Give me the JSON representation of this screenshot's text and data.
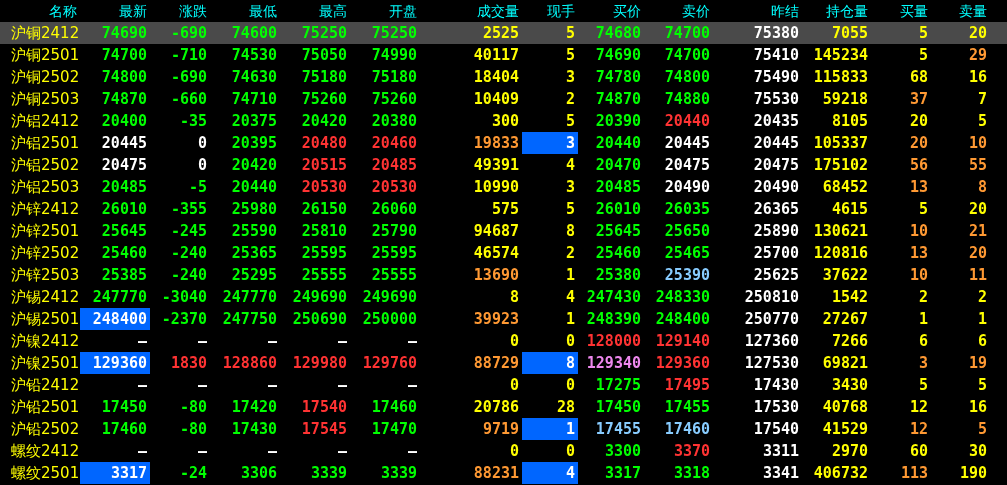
{
  "columns": [
    "名称",
    "最新",
    "涨跌",
    "最低",
    "最高",
    "开盘",
    "成交量",
    "现手",
    "买价",
    "卖价",
    "昨结",
    "持仓量",
    "买量",
    "卖量"
  ],
  "rows": [
    {
      "name": "沪铜2412",
      "selected": true,
      "cells": [
        {
          "text": "74690",
          "color": "#00ff00",
          "highlighted": false
        },
        {
          "text": "-690",
          "color": "#00ff00",
          "highlighted": false
        },
        {
          "text": "74600",
          "color": "#00ff00",
          "highlighted": false
        },
        {
          "text": "75250",
          "color": "#00ff00",
          "highlighted": false
        },
        {
          "text": "75250",
          "color": "#00ff00",
          "highlighted": false
        },
        {
          "text": "2525",
          "color": "#ffff00",
          "highlighted": false
        },
        {
          "text": "5",
          "color": "#ffff00",
          "highlighted": false
        },
        {
          "text": "74680",
          "color": "#00ff00",
          "highlighted": false
        },
        {
          "text": "74700",
          "color": "#00ff00",
          "highlighted": false
        },
        {
          "text": "75380",
          "color": "#ffffff",
          "highlighted": false
        },
        {
          "text": "7055",
          "color": "#ffff00",
          "highlighted": false
        },
        {
          "text": "5",
          "color": "#ffff00",
          "highlighted": false
        },
        {
          "text": "20",
          "color": "#ffff00",
          "highlighted": false
        }
      ]
    },
    {
      "name": "沪铜2501",
      "selected": false,
      "cells": [
        {
          "text": "74700",
          "color": "#00ff00",
          "highlighted": false
        },
        {
          "text": "-710",
          "color": "#00ff00",
          "highlighted": false
        },
        {
          "text": "74530",
          "color": "#00ff00",
          "highlighted": false
        },
        {
          "text": "75050",
          "color": "#00ff00",
          "highlighted": false
        },
        {
          "text": "74990",
          "color": "#00ff00",
          "highlighted": false
        },
        {
          "text": "40117",
          "color": "#ffff00",
          "highlighted": false
        },
        {
          "text": "5",
          "color": "#ffff00",
          "highlighted": false
        },
        {
          "text": "74690",
          "color": "#00ff00",
          "highlighted": false
        },
        {
          "text": "74700",
          "color": "#00ff00",
          "highlighted": false
        },
        {
          "text": "75410",
          "color": "#ffffff",
          "highlighted": false
        },
        {
          "text": "145234",
          "color": "#ffff00",
          "highlighted": false
        },
        {
          "text": "5",
          "color": "#ffff00",
          "highlighted": false
        },
        {
          "text": "29",
          "color": "#ff9933",
          "highlighted": false
        }
      ]
    },
    {
      "name": "沪铜2502",
      "selected": false,
      "cells": [
        {
          "text": "74800",
          "color": "#00ff00",
          "highlighted": false
        },
        {
          "text": "-690",
          "color": "#00ff00",
          "highlighted": false
        },
        {
          "text": "74630",
          "color": "#00ff00",
          "highlighted": false
        },
        {
          "text": "75180",
          "color": "#00ff00",
          "highlighted": false
        },
        {
          "text": "75180",
          "color": "#00ff00",
          "highlighted": false
        },
        {
          "text": "18404",
          "color": "#ffff00",
          "highlighted": false
        },
        {
          "text": "3",
          "color": "#ffff00",
          "highlighted": false
        },
        {
          "text": "74780",
          "color": "#00ff00",
          "highlighted": false
        },
        {
          "text": "74800",
          "color": "#00ff00",
          "highlighted": false
        },
        {
          "text": "75490",
          "color": "#ffffff",
          "highlighted": false
        },
        {
          "text": "115833",
          "color": "#ffff00",
          "highlighted": false
        },
        {
          "text": "68",
          "color": "#ffff00",
          "highlighted": false
        },
        {
          "text": "16",
          "color": "#ffff00",
          "highlighted": false
        }
      ]
    },
    {
      "name": "沪铜2503",
      "selected": false,
      "cells": [
        {
          "text": "74870",
          "color": "#00ff00",
          "highlighted": false
        },
        {
          "text": "-660",
          "color": "#00ff00",
          "highlighted": false
        },
        {
          "text": "74710",
          "color": "#00ff00",
          "highlighted": false
        },
        {
          "text": "75260",
          "color": "#00ff00",
          "highlighted": false
        },
        {
          "text": "75260",
          "color": "#00ff00",
          "highlighted": false
        },
        {
          "text": "10409",
          "color": "#ffff00",
          "highlighted": false
        },
        {
          "text": "2",
          "color": "#ffff00",
          "highlighted": false
        },
        {
          "text": "74870",
          "color": "#00ff00",
          "highlighted": false
        },
        {
          "text": "74880",
          "color": "#00ff00",
          "highlighted": false
        },
        {
          "text": "75530",
          "color": "#ffffff",
          "highlighted": false
        },
        {
          "text": "59218",
          "color": "#ffff00",
          "highlighted": false
        },
        {
          "text": "37",
          "color": "#ff9933",
          "highlighted": false
        },
        {
          "text": "7",
          "color": "#ffff00",
          "highlighted": false
        }
      ]
    },
    {
      "name": "沪铝2412",
      "selected": false,
      "cells": [
        {
          "text": "20400",
          "color": "#00ff00",
          "highlighted": false
        },
        {
          "text": "-35",
          "color": "#00ff00",
          "highlighted": false
        },
        {
          "text": "20375",
          "color": "#00ff00",
          "highlighted": false
        },
        {
          "text": "20420",
          "color": "#00ff00",
          "highlighted": false
        },
        {
          "text": "20380",
          "color": "#00ff00",
          "highlighted": false
        },
        {
          "text": "300",
          "color": "#ffff00",
          "highlighted": false
        },
        {
          "text": "5",
          "color": "#ffff00",
          "highlighted": false
        },
        {
          "text": "20390",
          "color": "#00ff00",
          "highlighted": false
        },
        {
          "text": "20440",
          "color": "#ff3333",
          "highlighted": false
        },
        {
          "text": "20435",
          "color": "#ffffff",
          "highlighted": false
        },
        {
          "text": "8105",
          "color": "#ffff00",
          "highlighted": false
        },
        {
          "text": "20",
          "color": "#ffff00",
          "highlighted": false
        },
        {
          "text": "5",
          "color": "#ffff00",
          "highlighted": false
        }
      ]
    },
    {
      "name": "沪铝2501",
      "selected": false,
      "cells": [
        {
          "text": "20445",
          "color": "#ffffff",
          "highlighted": false
        },
        {
          "text": "0",
          "color": "#ffffff",
          "highlighted": false
        },
        {
          "text": "20395",
          "color": "#00ff00",
          "highlighted": false
        },
        {
          "text": "20480",
          "color": "#ff3333",
          "highlighted": false
        },
        {
          "text": "20460",
          "color": "#ff3333",
          "highlighted": false
        },
        {
          "text": "19833",
          "color": "#ff9933",
          "highlighted": false
        },
        {
          "text": "3",
          "color": "#ffffff",
          "highlighted": true
        },
        {
          "text": "20440",
          "color": "#00ff00",
          "highlighted": false
        },
        {
          "text": "20445",
          "color": "#ffffff",
          "highlighted": false
        },
        {
          "text": "20445",
          "color": "#ffffff",
          "highlighted": false
        },
        {
          "text": "105337",
          "color": "#ffff00",
          "highlighted": false
        },
        {
          "text": "20",
          "color": "#ff9933",
          "highlighted": false
        },
        {
          "text": "10",
          "color": "#ff9933",
          "highlighted": false
        }
      ]
    },
    {
      "name": "沪铝2502",
      "selected": false,
      "cells": [
        {
          "text": "20475",
          "color": "#ffffff",
          "highlighted": false
        },
        {
          "text": "0",
          "color": "#ffffff",
          "highlighted": false
        },
        {
          "text": "20420",
          "color": "#00ff00",
          "highlighted": false
        },
        {
          "text": "20515",
          "color": "#ff3333",
          "highlighted": false
        },
        {
          "text": "20485",
          "color": "#ff3333",
          "highlighted": false
        },
        {
          "text": "49391",
          "color": "#ffff00",
          "highlighted": false
        },
        {
          "text": "4",
          "color": "#ffff00",
          "highlighted": false
        },
        {
          "text": "20470",
          "color": "#00ff00",
          "highlighted": false
        },
        {
          "text": "20475",
          "color": "#ffffff",
          "highlighted": false
        },
        {
          "text": "20475",
          "color": "#ffffff",
          "highlighted": false
        },
        {
          "text": "175102",
          "color": "#ffff00",
          "highlighted": false
        },
        {
          "text": "56",
          "color": "#ff9933",
          "highlighted": false
        },
        {
          "text": "55",
          "color": "#ff9933",
          "highlighted": false
        }
      ]
    },
    {
      "name": "沪铝2503",
      "selected": false,
      "cells": [
        {
          "text": "20485",
          "color": "#00ff00",
          "highlighted": false
        },
        {
          "text": "-5",
          "color": "#00ff00",
          "highlighted": false
        },
        {
          "text": "20440",
          "color": "#00ff00",
          "highlighted": false
        },
        {
          "text": "20530",
          "color": "#ff3333",
          "highlighted": false
        },
        {
          "text": "20530",
          "color": "#ff3333",
          "highlighted": false
        },
        {
          "text": "10990",
          "color": "#ffff00",
          "highlighted": false
        },
        {
          "text": "3",
          "color": "#ffff00",
          "highlighted": false
        },
        {
          "text": "20485",
          "color": "#00ff00",
          "highlighted": false
        },
        {
          "text": "20490",
          "color": "#ffffff",
          "highlighted": false
        },
        {
          "text": "20490",
          "color": "#ffffff",
          "highlighted": false
        },
        {
          "text": "68452",
          "color": "#ffff00",
          "highlighted": false
        },
        {
          "text": "13",
          "color": "#ff9933",
          "highlighted": false
        },
        {
          "text": "8",
          "color": "#ff9933",
          "highlighted": false
        }
      ]
    },
    {
      "name": "沪锌2412",
      "selected": false,
      "cells": [
        {
          "text": "26010",
          "color": "#00ff00",
          "highlighted": false
        },
        {
          "text": "-355",
          "color": "#00ff00",
          "highlighted": false
        },
        {
          "text": "25980",
          "color": "#00ff00",
          "highlighted": false
        },
        {
          "text": "26150",
          "color": "#00ff00",
          "highlighted": false
        },
        {
          "text": "26060",
          "color": "#00ff00",
          "highlighted": false
        },
        {
          "text": "575",
          "color": "#ffff00",
          "highlighted": false
        },
        {
          "text": "5",
          "color": "#ffff00",
          "highlighted": false
        },
        {
          "text": "26010",
          "color": "#00ff00",
          "highlighted": false
        },
        {
          "text": "26035",
          "color": "#00ff00",
          "highlighted": false
        },
        {
          "text": "26365",
          "color": "#ffffff",
          "highlighted": false
        },
        {
          "text": "4615",
          "color": "#ffff00",
          "highlighted": false
        },
        {
          "text": "5",
          "color": "#ffff00",
          "highlighted": false
        },
        {
          "text": "20",
          "color": "#ffff00",
          "highlighted": false
        }
      ]
    },
    {
      "name": "沪锌2501",
      "selected": false,
      "cells": [
        {
          "text": "25645",
          "color": "#00ff00",
          "highlighted": false
        },
        {
          "text": "-245",
          "color": "#00ff00",
          "highlighted": false
        },
        {
          "text": "25590",
          "color": "#00ff00",
          "highlighted": false
        },
        {
          "text": "25810",
          "color": "#00ff00",
          "highlighted": false
        },
        {
          "text": "25790",
          "color": "#00ff00",
          "highlighted": false
        },
        {
          "text": "94687",
          "color": "#ffff00",
          "highlighted": false
        },
        {
          "text": "8",
          "color": "#ffff00",
          "highlighted": false
        },
        {
          "text": "25645",
          "color": "#00ff00",
          "highlighted": false
        },
        {
          "text": "25650",
          "color": "#00ff00",
          "highlighted": false
        },
        {
          "text": "25890",
          "color": "#ffffff",
          "highlighted": false
        },
        {
          "text": "130621",
          "color": "#ffff00",
          "highlighted": false
        },
        {
          "text": "10",
          "color": "#ff9933",
          "highlighted": false
        },
        {
          "text": "21",
          "color": "#ff9933",
          "highlighted": false
        }
      ]
    },
    {
      "name": "沪锌2502",
      "selected": false,
      "cells": [
        {
          "text": "25460",
          "color": "#00ff00",
          "highlighted": false
        },
        {
          "text": "-240",
          "color": "#00ff00",
          "highlighted": false
        },
        {
          "text": "25365",
          "color": "#00ff00",
          "highlighted": false
        },
        {
          "text": "25595",
          "color": "#00ff00",
          "highlighted": false
        },
        {
          "text": "25595",
          "color": "#00ff00",
          "highlighted": false
        },
        {
          "text": "46574",
          "color": "#ffff00",
          "highlighted": false
        },
        {
          "text": "2",
          "color": "#ffff00",
          "highlighted": false
        },
        {
          "text": "25460",
          "color": "#00ff00",
          "highlighted": false
        },
        {
          "text": "25465",
          "color": "#00ff00",
          "highlighted": false
        },
        {
          "text": "25700",
          "color": "#ffffff",
          "highlighted": false
        },
        {
          "text": "120816",
          "color": "#ffff00",
          "highlighted": false
        },
        {
          "text": "13",
          "color": "#ff9933",
          "highlighted": false
        },
        {
          "text": "20",
          "color": "#ff9933",
          "highlighted": false
        }
      ]
    },
    {
      "name": "沪锌2503",
      "selected": false,
      "cells": [
        {
          "text": "25385",
          "color": "#00ff00",
          "highlighted": false
        },
        {
          "text": "-240",
          "color": "#00ff00",
          "highlighted": false
        },
        {
          "text": "25295",
          "color": "#00ff00",
          "highlighted": false
        },
        {
          "text": "25555",
          "color": "#00ff00",
          "highlighted": false
        },
        {
          "text": "25555",
          "color": "#00ff00",
          "highlighted": false
        },
        {
          "text": "13690",
          "color": "#ff9933",
          "highlighted": false
        },
        {
          "text": "1",
          "color": "#ffff00",
          "highlighted": false
        },
        {
          "text": "25380",
          "color": "#00ff00",
          "highlighted": false
        },
        {
          "text": "25390",
          "color": "#88ccff",
          "highlighted": false
        },
        {
          "text": "25625",
          "color": "#ffffff",
          "highlighted": false
        },
        {
          "text": "37622",
          "color": "#ffff00",
          "highlighted": false
        },
        {
          "text": "10",
          "color": "#ff9933",
          "highlighted": false
        },
        {
          "text": "11",
          "color": "#ff9933",
          "highlighted": false
        }
      ]
    },
    {
      "name": "沪锡2412",
      "selected": false,
      "cells": [
        {
          "text": "247770",
          "color": "#00ff00",
          "highlighted": false
        },
        {
          "text": "-3040",
          "color": "#00ff00",
          "highlighted": false
        },
        {
          "text": "247770",
          "color": "#00ff00",
          "highlighted": false
        },
        {
          "text": "249690",
          "color": "#00ff00",
          "highlighted": false
        },
        {
          "text": "249690",
          "color": "#00ff00",
          "highlighted": false
        },
        {
          "text": "8",
          "color": "#ffff00",
          "highlighted": false
        },
        {
          "text": "4",
          "color": "#ffff00",
          "highlighted": false
        },
        {
          "text": "247430",
          "color": "#00ff00",
          "highlighted": false
        },
        {
          "text": "248330",
          "color": "#00ff00",
          "highlighted": false
        },
        {
          "text": "250810",
          "color": "#ffffff",
          "highlighted": false
        },
        {
          "text": "1542",
          "color": "#ffff00",
          "highlighted": false
        },
        {
          "text": "2",
          "color": "#ffff00",
          "highlighted": false
        },
        {
          "text": "2",
          "color": "#ffff00",
          "highlighted": false
        }
      ]
    },
    {
      "name": "沪锡2501",
      "selected": false,
      "cells": [
        {
          "text": "248400",
          "color": "#ffffff",
          "highlighted": true
        },
        {
          "text": "-2370",
          "color": "#00ff00",
          "highlighted": false
        },
        {
          "text": "247750",
          "color": "#00ff00",
          "highlighted": false
        },
        {
          "text": "250690",
          "color": "#00ff00",
          "highlighted": false
        },
        {
          "text": "250000",
          "color": "#00ff00",
          "highlighted": false
        },
        {
          "text": "39923",
          "color": "#ff9933",
          "highlighted": false
        },
        {
          "text": "1",
          "color": "#ffff00",
          "highlighted": false
        },
        {
          "text": "248390",
          "color": "#00ff00",
          "highlighted": false
        },
        {
          "text": "248400",
          "color": "#00ff00",
          "highlighted": false
        },
        {
          "text": "250770",
          "color": "#ffffff",
          "highlighted": false
        },
        {
          "text": "27267",
          "color": "#ffff00",
          "highlighted": false
        },
        {
          "text": "1",
          "color": "#ffff00",
          "highlighted": false
        },
        {
          "text": "1",
          "color": "#ffff00",
          "highlighted": false
        }
      ]
    },
    {
      "name": "沪镍2412",
      "selected": false,
      "cells": [
        {
          "text": "—",
          "color": "#ffffff",
          "highlighted": false
        },
        {
          "text": "—",
          "color": "#ffffff",
          "highlighted": false
        },
        {
          "text": "—",
          "color": "#ffffff",
          "highlighted": false
        },
        {
          "text": "—",
          "color": "#ffffff",
          "highlighted": false
        },
        {
          "text": "—",
          "color": "#ffffff",
          "highlighted": false
        },
        {
          "text": "0",
          "color": "#ffff00",
          "highlighted": false
        },
        {
          "text": "0",
          "color": "#ffff00",
          "highlighted": false
        },
        {
          "text": "128000",
          "color": "#ff3333",
          "highlighted": false
        },
        {
          "text": "129140",
          "color": "#ff3333",
          "highlighted": false
        },
        {
          "text": "127360",
          "color": "#ffffff",
          "highlighted": false
        },
        {
          "text": "7266",
          "color": "#ffff00",
          "highlighted": false
        },
        {
          "text": "6",
          "color": "#ffff00",
          "highlighted": false
        },
        {
          "text": "6",
          "color": "#ffff00",
          "highlighted": false
        }
      ]
    },
    {
      "name": "沪镍2501",
      "selected": false,
      "cells": [
        {
          "text": "129360",
          "color": "#ffffff",
          "highlighted": true
        },
        {
          "text": "1830",
          "color": "#ff3333",
          "highlighted": false
        },
        {
          "text": "128860",
          "color": "#ff3333",
          "highlighted": false
        },
        {
          "text": "129980",
          "color": "#ff3333",
          "highlighted": false
        },
        {
          "text": "129760",
          "color": "#ff3333",
          "highlighted": false
        },
        {
          "text": "88729",
          "color": "#ff9933",
          "highlighted": false
        },
        {
          "text": "8",
          "color": "#ffffff",
          "highlighted": true
        },
        {
          "text": "129340",
          "color": "#ee88ee",
          "highlighted": false
        },
        {
          "text": "129360",
          "color": "#ff3333",
          "highlighted": false
        },
        {
          "text": "127530",
          "color": "#ffffff",
          "highlighted": false
        },
        {
          "text": "69821",
          "color": "#ffff00",
          "highlighted": false
        },
        {
          "text": "3",
          "color": "#ff9933",
          "highlighted": false
        },
        {
          "text": "19",
          "color": "#ff9933",
          "highlighted": false
        }
      ]
    },
    {
      "name": "沪铅2412",
      "selected": false,
      "cells": [
        {
          "text": "—",
          "color": "#ffffff",
          "highlighted": false
        },
        {
          "text": "—",
          "color": "#ffffff",
          "highlighted": false
        },
        {
          "text": "—",
          "color": "#ffffff",
          "highlighted": false
        },
        {
          "text": "—",
          "color": "#ffffff",
          "highlighted": false
        },
        {
          "text": "—",
          "color": "#ffffff",
          "highlighted": false
        },
        {
          "text": "0",
          "color": "#ffff00",
          "highlighted": false
        },
        {
          "text": "0",
          "color": "#ffff00",
          "highlighted": false
        },
        {
          "text": "17275",
          "color": "#00ff00",
          "highlighted": false
        },
        {
          "text": "17495",
          "color": "#ff3333",
          "highlighted": false
        },
        {
          "text": "17430",
          "color": "#ffffff",
          "highlighted": false
        },
        {
          "text": "3430",
          "color": "#ffff00",
          "highlighted": false
        },
        {
          "text": "5",
          "color": "#ffff00",
          "highlighted": false
        },
        {
          "text": "5",
          "color": "#ffff00",
          "highlighted": false
        }
      ]
    },
    {
      "name": "沪铅2501",
      "selected": false,
      "cells": [
        {
          "text": "17450",
          "color": "#00ff00",
          "highlighted": false
        },
        {
          "text": "-80",
          "color": "#00ff00",
          "highlighted": false
        },
        {
          "text": "17420",
          "color": "#00ff00",
          "highlighted": false
        },
        {
          "text": "17540",
          "color": "#ff3333",
          "highlighted": false
        },
        {
          "text": "17460",
          "color": "#00ff00",
          "highlighted": false
        },
        {
          "text": "20786",
          "color": "#ffff00",
          "highlighted": false
        },
        {
          "text": "28",
          "color": "#ffff00",
          "highlighted": false
        },
        {
          "text": "17450",
          "color": "#00ff00",
          "highlighted": false
        },
        {
          "text": "17455",
          "color": "#00ff00",
          "highlighted": false
        },
        {
          "text": "17530",
          "color": "#ffffff",
          "highlighted": false
        },
        {
          "text": "40768",
          "color": "#ffff00",
          "highlighted": false
        },
        {
          "text": "12",
          "color": "#ffff00",
          "highlighted": false
        },
        {
          "text": "16",
          "color": "#ffff00",
          "highlighted": false
        }
      ]
    },
    {
      "name": "沪铅2502",
      "selected": false,
      "cells": [
        {
          "text": "17460",
          "color": "#00ff00",
          "highlighted": false
        },
        {
          "text": "-80",
          "color": "#00ff00",
          "highlighted": false
        },
        {
          "text": "17430",
          "color": "#00ff00",
          "highlighted": false
        },
        {
          "text": "17545",
          "color": "#ff3333",
          "highlighted": false
        },
        {
          "text": "17470",
          "color": "#00ff00",
          "highlighted": false
        },
        {
          "text": "9719",
          "color": "#ff9933",
          "highlighted": false
        },
        {
          "text": "1",
          "color": "#ffffff",
          "highlighted": true
        },
        {
          "text": "17455",
          "color": "#88ccff",
          "highlighted": false
        },
        {
          "text": "17460",
          "color": "#88ccff",
          "highlighted": false
        },
        {
          "text": "17540",
          "color": "#ffffff",
          "highlighted": false
        },
        {
          "text": "41529",
          "color": "#ffff00",
          "highlighted": false
        },
        {
          "text": "12",
          "color": "#ff9933",
          "highlighted": false
        },
        {
          "text": "5",
          "color": "#ff9933",
          "highlighted": false
        }
      ]
    },
    {
      "name": "螺纹2412",
      "selected": false,
      "cells": [
        {
          "text": "—",
          "color": "#ffffff",
          "highlighted": false
        },
        {
          "text": "—",
          "color": "#ffffff",
          "highlighted": false
        },
        {
          "text": "—",
          "color": "#ffffff",
          "highlighted": false
        },
        {
          "text": "—",
          "color": "#ffffff",
          "highlighted": false
        },
        {
          "text": "—",
          "color": "#ffffff",
          "highlighted": false
        },
        {
          "text": "0",
          "color": "#ffff00",
          "highlighted": false
        },
        {
          "text": "0",
          "color": "#ffff00",
          "highlighted": false
        },
        {
          "text": "3300",
          "color": "#00ff00",
          "highlighted": false
        },
        {
          "text": "3370",
          "color": "#ff3333",
          "highlighted": false
        },
        {
          "text": "3311",
          "color": "#ffffff",
          "highlighted": false
        },
        {
          "text": "2970",
          "color": "#ffff00",
          "highlighted": false
        },
        {
          "text": "60",
          "color": "#ffff00",
          "highlighted": false
        },
        {
          "text": "30",
          "color": "#ffff00",
          "highlighted": false
        }
      ]
    },
    {
      "name": "螺纹2501",
      "selected": false,
      "cells": [
        {
          "text": "3317",
          "color": "#ffffff",
          "highlighted": true
        },
        {
          "text": "-24",
          "color": "#00ff00",
          "highlighted": false
        },
        {
          "text": "3306",
          "color": "#00ff00",
          "highlighted": false
        },
        {
          "text": "3339",
          "color": "#00ff00",
          "highlighted": false
        },
        {
          "text": "3339",
          "color": "#00ff00",
          "highlighted": false
        },
        {
          "text": "88231",
          "color": "#ff9933",
          "highlighted": false
        },
        {
          "text": "4",
          "color": "#ffffff",
          "highlighted": true
        },
        {
          "text": "3317",
          "color": "#00ff00",
          "highlighted": false
        },
        {
          "text": "3318",
          "color": "#00ff00",
          "highlighted": false
        },
        {
          "text": "3341",
          "color": "#ffffff",
          "highlighted": false
        },
        {
          "text": "406732",
          "color": "#ffff00",
          "highlighted": false
        },
        {
          "text": "113",
          "color": "#ff9933",
          "highlighted": false
        },
        {
          "text": "190",
          "color": "#ffff00",
          "highlighted": false
        }
      ]
    }
  ]
}
